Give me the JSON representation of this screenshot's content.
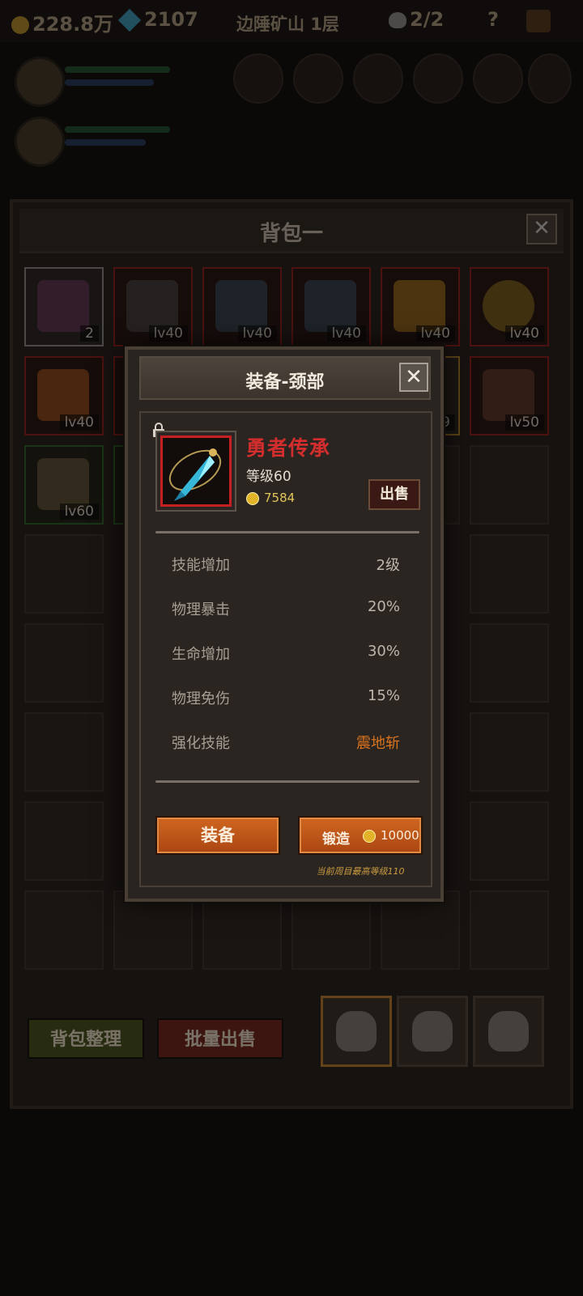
{
  "topbar": {
    "gold": "228.8万",
    "gems": "2107",
    "location": "边陲矿山 1层",
    "skull_count": "2/2",
    "help": "?"
  },
  "bag": {
    "title": "背包一",
    "close": "✕",
    "slots": [
      {
        "label": "2"
      },
      {
        "label": "lv40"
      },
      {
        "label": "lv40"
      },
      {
        "label": "lv40"
      },
      {
        "label": "lv40"
      },
      {
        "label": "lv40"
      },
      {
        "label": "lv40"
      },
      {
        "label": ""
      },
      {
        "label": ""
      },
      {
        "label": ""
      },
      {
        "label": "9"
      },
      {
        "label": "lv50"
      },
      {
        "label": "lv60"
      }
    ],
    "organize_button": "背包整理",
    "bulk_sell_button": "批量出售"
  },
  "dialog": {
    "title": "装备-颈部",
    "close": "✕",
    "item": {
      "name": "勇者传承",
      "level": "等级60",
      "price": "7584",
      "sell_button": "出售"
    },
    "stats": [
      {
        "label": "技能增加",
        "value": "2级"
      },
      {
        "label": "物理暴击",
        "value": "20%"
      },
      {
        "label": "生命增加",
        "value": "30%"
      },
      {
        "label": "物理免伤",
        "value": "15%"
      },
      {
        "label": "强化技能",
        "value": "震地斩"
      }
    ],
    "equip_button": "装备",
    "forge_button": "锻造",
    "forge_cost": "10000",
    "forge_note": "当前周目最高等级110"
  },
  "colors": {
    "item_name": "#d42d2d",
    "special_skill": "#d9731d",
    "button_orange": "#c55c1c"
  }
}
